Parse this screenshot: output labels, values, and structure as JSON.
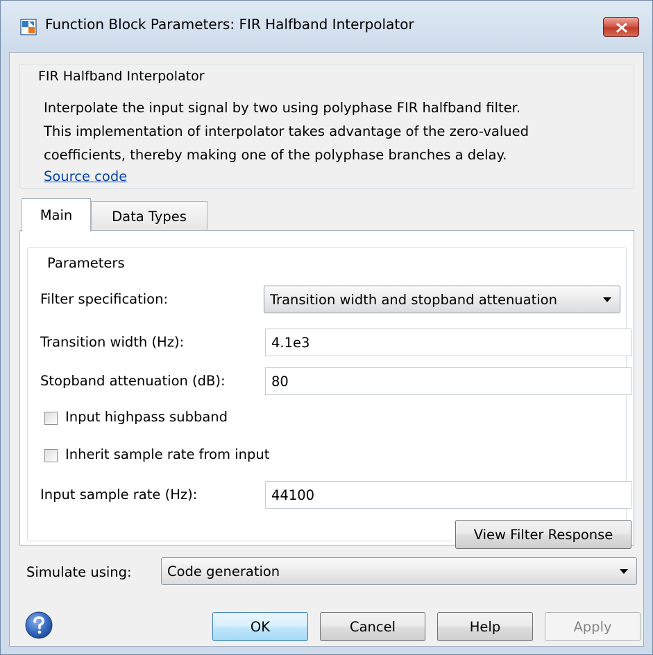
{
  "window": {
    "title": "Function Block Parameters: FIR Halfband Interpolator"
  },
  "description": {
    "group_title": "FIR Halfband Interpolator",
    "lines": [
      "Interpolate the input signal by two using polyphase FIR halfband filter.",
      "This implementation of interpolator takes advantage of the zero-valued",
      "coefficients, thereby making one of the polyphase branches a delay."
    ],
    "link_label": "Source code"
  },
  "tabs": [
    {
      "label": "Main",
      "selected": true
    },
    {
      "label": "Data Types",
      "selected": false
    }
  ],
  "parameters": {
    "group_title": "Parameters",
    "filter_spec_label": "Filter specification:",
    "filter_spec_value": "Transition width and stopband attenuation",
    "transition_width_label": "Transition width (Hz):",
    "transition_width_value": "4.1e3",
    "stopband_label": "Stopband attenuation (dB):",
    "stopband_value": "80",
    "highpass_label": "Input highpass subband",
    "highpass_checked": false,
    "inherit_label": "Inherit sample rate from input",
    "inherit_checked": false,
    "sample_rate_label": "Input sample rate (Hz):",
    "sample_rate_value": "44100",
    "view_response_label": "View Filter Response"
  },
  "simulate": {
    "label": "Simulate using:",
    "value": "Code generation"
  },
  "buttons": {
    "ok": "OK",
    "cancel": "Cancel",
    "help": "Help",
    "apply": "Apply"
  },
  "colors": {
    "accent": "#3c7fb1",
    "link": "#0645ad",
    "close": "#c13c2c"
  }
}
